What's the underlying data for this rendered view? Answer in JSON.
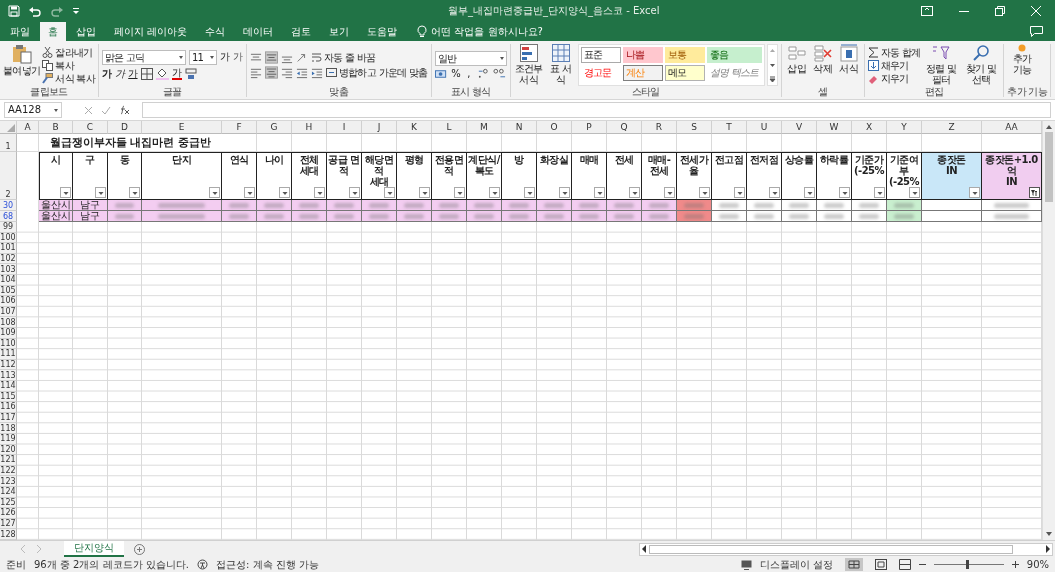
{
  "window": {
    "title": "월부_내집마련중급반_단지양식_음스코  -  Excel"
  },
  "ribbon_tabs": [
    {
      "label": "파일",
      "selected": false
    },
    {
      "label": "홈",
      "selected": true
    },
    {
      "label": "삽입",
      "selected": false
    },
    {
      "label": "페이지 레이아웃",
      "selected": false
    },
    {
      "label": "수식",
      "selected": false
    },
    {
      "label": "데이터",
      "selected": false
    },
    {
      "label": "검토",
      "selected": false
    },
    {
      "label": "보기",
      "selected": false
    },
    {
      "label": "도움말",
      "selected": false
    }
  ],
  "tell_me": "어떤 작업을 원하시나요?",
  "clipboard": {
    "label": "클립보드",
    "paste": "붙여넣기",
    "cut": "잘라내기",
    "copy": "복사",
    "format_painter": "서식 복사"
  },
  "font": {
    "label": "글꼴",
    "font_name": "맑은 고딕",
    "font_size": "11",
    "grow": "가",
    "shrink": "가",
    "bold": "가",
    "italic": "가",
    "underline": "가",
    "font_color": "가"
  },
  "alignment": {
    "label": "맞춤",
    "wrap_text": "자동 줄 바꿈",
    "merge_center": "병합하고 가운데 맞춤"
  },
  "number": {
    "label": "표시 형식",
    "format": "일반",
    "percent": "%",
    "comma": ","
  },
  "styles": {
    "label": "스타일",
    "conditional": "조건부 서식",
    "format_table": "표 서식",
    "cell_styles": [
      {
        "label": "표준",
        "kind": "normal"
      },
      {
        "label": "나쁨",
        "kind": "bad"
      },
      {
        "label": "보통",
        "kind": "neutral"
      },
      {
        "label": "좋음",
        "kind": "good"
      },
      {
        "label": "경고문",
        "kind": "warning"
      },
      {
        "label": "계산",
        "kind": "calculation"
      },
      {
        "label": "메모",
        "kind": "note"
      },
      {
        "label": "설명 텍스트",
        "kind": "explanatory"
      }
    ]
  },
  "cells": {
    "label": "셀",
    "insert": "삽입",
    "delete": "삭제",
    "format": "서식"
  },
  "editing": {
    "label": "편집",
    "autosum": "자동 합계",
    "fill": "채우기",
    "clear": "지우기",
    "sort_filter": "정렬 및 필터",
    "find_select": "찾기 및 선택"
  },
  "addins": {
    "label": "추가 기능",
    "button": "추가 기능"
  },
  "formula_bar": {
    "name_box": "AA128"
  },
  "sheet": {
    "title": "월급쟁이부자들 내집마련 중급반",
    "top_rows": [
      "1",
      "2"
    ],
    "columns": [
      {
        "letter": "A"
      },
      {
        "letter": "B",
        "header": "시",
        "color": "#ffffff",
        "filter_applied": false
      },
      {
        "letter": "C",
        "header": "구",
        "color": "#ffffff",
        "filter_applied": false
      },
      {
        "letter": "D",
        "header": "동",
        "color": "#ffffff",
        "filter_applied": false
      },
      {
        "letter": "E",
        "header": "단지",
        "color": "#ffffff",
        "filter_applied": false
      },
      {
        "letter": "F",
        "header": "연식",
        "color": "#ffffff",
        "filter_applied": false
      },
      {
        "letter": "G",
        "header": "나이",
        "color": "#ffffff",
        "filter_applied": false
      },
      {
        "letter": "H",
        "header": "전체\n세대",
        "color": "#ffffff",
        "filter_applied": false
      },
      {
        "letter": "I",
        "header": "공급 면적",
        "color": "#ffffff",
        "filter_applied": false
      },
      {
        "letter": "J",
        "header": "해당면적\n세대",
        "color": "#ffffff",
        "filter_applied": false
      },
      {
        "letter": "K",
        "header": "평형",
        "color": "#ffffff",
        "filter_applied": false
      },
      {
        "letter": "L",
        "header": "전용면적",
        "color": "#ffffff",
        "filter_applied": false
      },
      {
        "letter": "M",
        "header": "계단식/\n복도",
        "color": "#ffffff",
        "filter_applied": false
      },
      {
        "letter": "N",
        "header": "방",
        "color": "#ffffff",
        "filter_applied": false
      },
      {
        "letter": "O",
        "header": "화장실",
        "color": "#ffffff",
        "filter_applied": false
      },
      {
        "letter": "P",
        "header": "매매",
        "color": "#ffffff",
        "filter_applied": false
      },
      {
        "letter": "Q",
        "header": "전세",
        "color": "#ffffff",
        "filter_applied": false
      },
      {
        "letter": "R",
        "header": "매매-전세",
        "color": "#ffffff",
        "filter_applied": false
      },
      {
        "letter": "S",
        "header": "전세가율",
        "color": "#ffffff",
        "filter_applied": false
      },
      {
        "letter": "T",
        "header": "전고점",
        "color": "#ffffff",
        "filter_applied": false
      },
      {
        "letter": "U",
        "header": "전저점",
        "color": "#ffffff",
        "filter_applied": false
      },
      {
        "letter": "V",
        "header": "상승률",
        "color": "#ffffff",
        "filter_applied": false
      },
      {
        "letter": "W",
        "header": "하락률",
        "color": "#ffffff",
        "filter_applied": false
      },
      {
        "letter": "X",
        "header": "기준가\n(-25%",
        "color": "#ffffff",
        "filter_applied": false
      },
      {
        "letter": "Y",
        "header": "기준여부\n(-25%",
        "color": "#ffffff",
        "filter_applied": false
      },
      {
        "letter": "Z",
        "header": "종잣돈\nIN",
        "color": "#c9e7f8",
        "filter_applied": false
      },
      {
        "letter": "AA",
        "header": "종잣돈+1.0억\nIN",
        "color": "#f1cdf0",
        "filter_applied": true
      }
    ],
    "rows": [
      {
        "number": "30",
        "filtered": true,
        "cells": [
          {
            "kind": "none"
          },
          {
            "kind": "text",
            "text": "울산시",
            "color": "#f3cdf1"
          },
          {
            "kind": "text",
            "text": "남구",
            "color": "#f3cdf1"
          },
          {
            "kind": "blurred",
            "color": "#f3cdf1"
          },
          {
            "kind": "blurred",
            "color": "#f3cdf1"
          },
          {
            "kind": "blurred",
            "color": "#f3cdf1"
          },
          {
            "kind": "blurred",
            "color": "#f3cdf1"
          },
          {
            "kind": "blurred",
            "color": "#f3cdf1"
          },
          {
            "kind": "blurred",
            "color": "#f3cdf1"
          },
          {
            "kind": "blurred",
            "color": "#f3cdf1"
          },
          {
            "kind": "blurred",
            "color": "#f3cdf1"
          },
          {
            "kind": "blurred",
            "color": "#f3cdf1"
          },
          {
            "kind": "blurred",
            "color": "#f3cdf1"
          },
          {
            "kind": "blurred",
            "color": "#f3cdf1"
          },
          {
            "kind": "blurred",
            "color": "#f3cdf1"
          },
          {
            "kind": "blurred",
            "color": "#f3cdf1"
          },
          {
            "kind": "blurred",
            "color": "#f3cdf1"
          },
          {
            "kind": "blurred",
            "color": "#f3cdf1"
          },
          {
            "kind": "blurred",
            "color": "#f08a8a"
          },
          {
            "kind": "blurred",
            "color": "#ffffff"
          },
          {
            "kind": "blurred",
            "color": "#ffffff"
          },
          {
            "kind": "blurred",
            "color": "#ffffff"
          },
          {
            "kind": "blurred",
            "color": "#ffffff"
          },
          {
            "kind": "blurred",
            "color": "#ffffff"
          },
          {
            "kind": "blurred",
            "color": "#c9efcf"
          },
          {
            "kind": "empty"
          },
          {
            "kind": "blurred",
            "color": "#ffffff"
          }
        ]
      },
      {
        "number": "68",
        "filtered": true,
        "cells": [
          {
            "kind": "none"
          },
          {
            "kind": "text",
            "text": "울산시",
            "color": "#f3cdf1"
          },
          {
            "kind": "text",
            "text": "남구",
            "color": "#f3cdf1"
          },
          {
            "kind": "blurred",
            "color": "#f3cdf1"
          },
          {
            "kind": "blurred",
            "color": "#f3cdf1"
          },
          {
            "kind": "blurred",
            "color": "#f3cdf1"
          },
          {
            "kind": "blurred",
            "color": "#f3cdf1"
          },
          {
            "kind": "blurred",
            "color": "#f3cdf1"
          },
          {
            "kind": "blurred",
            "color": "#f3cdf1"
          },
          {
            "kind": "blurred",
            "color": "#f3cdf1"
          },
          {
            "kind": "blurred",
            "color": "#f3cdf1"
          },
          {
            "kind": "blurred",
            "color": "#f3cdf1"
          },
          {
            "kind": "blurred",
            "color": "#f3cdf1"
          },
          {
            "kind": "blurred",
            "color": "#f3cdf1"
          },
          {
            "kind": "blurred",
            "color": "#f3cdf1"
          },
          {
            "kind": "blurred",
            "color": "#f3cdf1"
          },
          {
            "kind": "blurred",
            "color": "#f3cdf1"
          },
          {
            "kind": "blurred",
            "color": "#f3cdf1"
          },
          {
            "kind": "blurred",
            "color": "#f08a8a"
          },
          {
            "kind": "blurred",
            "color": "#ffffff"
          },
          {
            "kind": "blurred",
            "color": "#ffffff"
          },
          {
            "kind": "blurred",
            "color": "#ffffff"
          },
          {
            "kind": "blurred",
            "color": "#ffffff"
          },
          {
            "kind": "blurred",
            "color": "#ffffff"
          },
          {
            "kind": "blurred",
            "color": "#c9efcf"
          },
          {
            "kind": "empty"
          },
          {
            "kind": "blurred",
            "color": "#ffffff"
          }
        ]
      }
    ],
    "empty_rows": [
      "99",
      "100",
      "101",
      "102",
      "103",
      "104",
      "105",
      "106",
      "107",
      "108",
      "109",
      "110",
      "111",
      "112",
      "113",
      "114",
      "115",
      "116",
      "117",
      "118",
      "119",
      "120",
      "121",
      "122",
      "123",
      "124",
      "125",
      "126",
      "127",
      "128"
    ]
  },
  "sheet_tabs": [
    {
      "label": "단지양식",
      "selected": true
    }
  ],
  "status_bar": {
    "mode": "준비",
    "records": "96개 중 2개의 레코드가 있습니다.",
    "accessibility": "접근성: 계속 진행 가능",
    "display_settings": "디스플레이 설정",
    "zoom_slider": {
      "level": 0.47
    },
    "zoom": "90%"
  }
}
